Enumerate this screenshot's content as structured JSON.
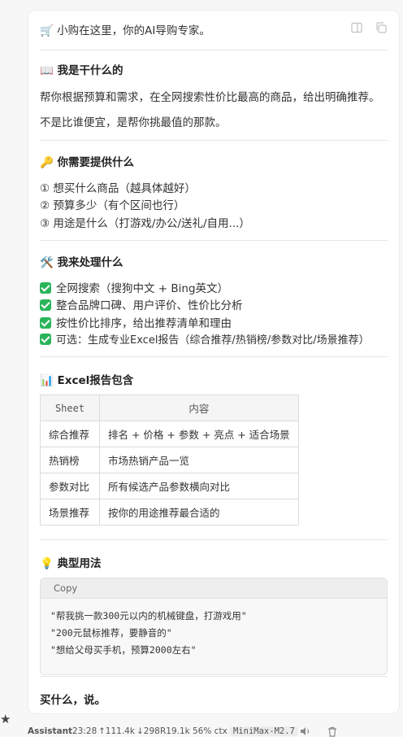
{
  "header": {
    "icon": "🛒",
    "text": "小购在这里，你的AI导购专家。"
  },
  "about": {
    "icon": "📖",
    "title": "我是干什么的",
    "p1": "帮你根据预算和需求，在全网搜索性价比最高的商品，给出明确推荐。",
    "p2": "不是比谁便宜，是帮你挑最值的那款。"
  },
  "need": {
    "icon": "🔑",
    "title": "你需要提供什么",
    "items": [
      "① 想买什么商品（越具体越好）",
      "② 预算多少（有个区间也行）",
      "③ 用途是什么（打游戏/办公/送礼/自用...）"
    ]
  },
  "handle": {
    "icon": "🛠️",
    "title": "我来处理什么",
    "items": [
      "全网搜索（搜狗中文 + Bing英文）",
      "整合品牌口碑、用户评价、性价比分析",
      "按性价比排序，给出推荐清单和理由",
      "可选：生成专业Excel报告（综合推荐/热销榜/参数对比/场景推荐）"
    ]
  },
  "excel": {
    "icon": "📊",
    "title": "Excel报告包含",
    "columns": [
      "Sheet",
      "内容"
    ],
    "rows": [
      [
        "综合推荐",
        "排名 + 价格 + 参数 + 亮点 + 适合场景"
      ],
      [
        "热销榜",
        "市场热销产品一览"
      ],
      [
        "参数对比",
        "所有候选产品参数横向对比"
      ],
      [
        "场景推荐",
        "按你的用途推荐最合适的"
      ]
    ]
  },
  "usage": {
    "icon": "💡",
    "title": "典型用法",
    "copy_label": "Copy",
    "lines": [
      "\"帮我挑一款300元以内的机械键盘，打游戏用\"",
      "\"200元鼠标推荐，要静音的\"",
      "\"想给父母买手机，预算2000左右\""
    ]
  },
  "closing": "买什么，说。",
  "footer": {
    "role": "Assistant",
    "time": "23:28",
    "in_tokens": "↑111.4k",
    "out_tokens": "↓298",
    "read": "R19.1k",
    "ctx": "56% ctx",
    "model": "MiniMax-M2.7"
  },
  "colors": {
    "check": "#2bb55a",
    "card_bg": "#ffffff",
    "page_bg": "#f7f7f8"
  }
}
